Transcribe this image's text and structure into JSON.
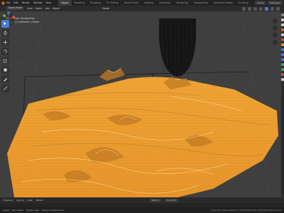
{
  "app": {
    "menu": [
      "File",
      "Edit",
      "Render",
      "Window",
      "Help"
    ],
    "workspaces": [
      "Layout",
      "Modeling",
      "Sculpting",
      "UV Editing",
      "Texture Paint",
      "Shading",
      "Animation",
      "Rendering",
      "Compositing",
      "Geometry Nodes",
      "Scripting"
    ],
    "active_workspace": "Layout",
    "scene_field": "Scene",
    "view_layer_field": "ViewLayer"
  },
  "header": {
    "mode": "Object Mode",
    "menus": [
      "View",
      "Select",
      "Add",
      "Object"
    ],
    "transform": "Global"
  },
  "viewport": {
    "perspective_label": "User Perspective",
    "collection_label": "(1) Collection | Plane"
  },
  "timeline": {
    "labels": [
      "Playback",
      "Keying",
      "View",
      "Marker"
    ],
    "start": "Start 1",
    "end": "End 250"
  },
  "statusbar": {
    "items": [
      "Select",
      "Box Select",
      "Rotate View",
      "Object Context Menu"
    ],
    "right_text": "Collection | Plane  Verts 0 | 4,031,681  Faces 4,000,000  Objects 1/2"
  },
  "colors": {
    "terrain": "#f0a030",
    "accent": "#4a7ad6"
  }
}
